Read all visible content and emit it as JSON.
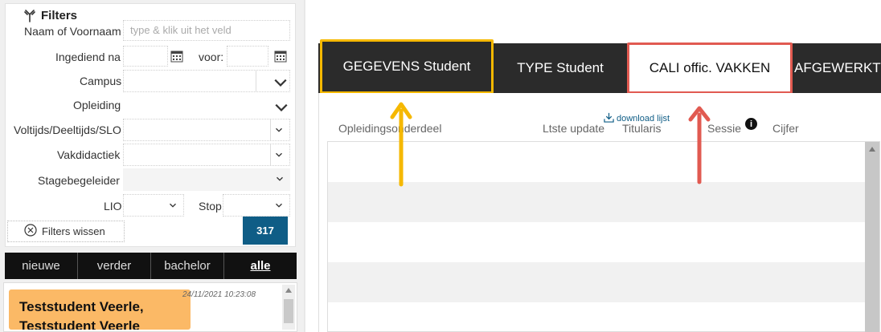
{
  "filters": {
    "title": "Filters",
    "name_label": "Naam of Voornaam",
    "name_placeholder": "type & klik uit het veld",
    "submitted_label": "Ingediend na",
    "before_label": "voor:",
    "campus_label": "Campus",
    "education_label": "Opleiding",
    "mode_label": "Voltijds/Deeltijds/SLO",
    "didactics_label": "Vakdidactiek",
    "supervisor_label": "Stagebegeleider",
    "lio_label": "LIO",
    "stop_label": "Stop",
    "clear_label": "Filters wissen",
    "count": "317"
  },
  "left_tabs": [
    {
      "label": "nieuwe"
    },
    {
      "label": "verder"
    },
    {
      "label": "bachelor"
    },
    {
      "label": "alle"
    }
  ],
  "student": {
    "name": "Teststudent Veerle,",
    "name2": "Teststudent Veerle",
    "timestamp": "24/11/2021 10:23:08"
  },
  "tabs": [
    {
      "label": "GEGEVENS Student"
    },
    {
      "label": "TYPE Student"
    },
    {
      "label": "CALI offic. VAKKEN"
    },
    {
      "label": "AFGEWERKT"
    }
  ],
  "content": {
    "download_label": "download lijst",
    "columns": [
      "Opleidingsonderdeel",
      "Ltste update",
      "Titularis",
      "Sessie",
      "Cijfer"
    ]
  },
  "colors": {
    "highlight_yellow": "#f5b800",
    "highlight_red": "#e15a51",
    "count_button": "#0f5d86",
    "student_card": "#fbb966"
  }
}
